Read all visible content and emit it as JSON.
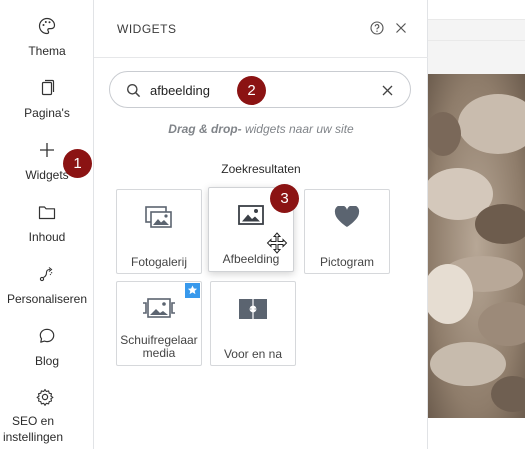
{
  "sidebar": {
    "items": [
      {
        "label": "Thema",
        "icon": "palette-icon"
      },
      {
        "label": "Pagina's",
        "icon": "pages-icon"
      },
      {
        "label": "Widgets",
        "icon": "plus-icon"
      },
      {
        "label": "Inhoud",
        "icon": "folder-icon"
      },
      {
        "label": "Personaliseren",
        "icon": "personalize-icon"
      },
      {
        "label": "Blog",
        "icon": "chat-bubble-icon"
      },
      {
        "label": "SEO en instellingen",
        "icon": "gear-icon"
      }
    ]
  },
  "panel": {
    "title": "WIDGETS",
    "search": {
      "value": "afbeelding"
    },
    "hint_bold": "Drag & drop-",
    "hint_rest": " widgets naar uw site",
    "results_title": "Zoekresultaten",
    "tiles": [
      {
        "label": "Fotogalerij",
        "icon": "photo-gallery-icon"
      },
      {
        "label": "Afbeelding",
        "icon": "image-icon"
      },
      {
        "label": "Pictogram",
        "icon": "heart-icon"
      },
      {
        "label": "Schuifregelaar media",
        "icon": "media-slider-icon",
        "premium": true
      },
      {
        "label": "Voor en na",
        "icon": "before-after-icon"
      }
    ]
  },
  "annotations": [
    "1",
    "2",
    "3"
  ],
  "colors": {
    "badge": "#8b1313",
    "icon_gray": "#5b6470",
    "star_badge": "#3899ec"
  }
}
